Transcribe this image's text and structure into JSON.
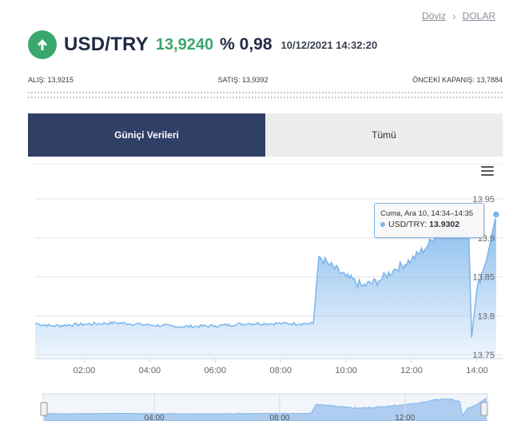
{
  "breadcrumb": {
    "items": [
      "Döviz",
      "DOLAR"
    ]
  },
  "header": {
    "pair": "USD/TRY",
    "price": "13,9240",
    "change": "% 0,98",
    "datetime": "10/12/2021 14:32:20",
    "trend_icon": "arrow-up-icon",
    "up_color": "#3aa76d"
  },
  "info": {
    "buy": "ALIŞ: 13,9215",
    "sell": "SATIŞ: 13,9392",
    "prev_close": "ÖNCEKİ KAPANIŞ: 13,7884"
  },
  "tabs": [
    {
      "label": "Güniçi Verileri",
      "active": true
    },
    {
      "label": "Tümü",
      "active": false
    }
  ],
  "tooltip": {
    "title": "Cuma, Ara 10, 14:34–14:35",
    "series": "USD/TRY: ",
    "value": "13.9302"
  },
  "chart_data": {
    "type": "area",
    "series_name": "USD/TRY",
    "color": "#7cb5ec",
    "x_ticks": [
      "02:00",
      "04:00",
      "06:00",
      "08:00",
      "10:00",
      "12:00",
      "14:00"
    ],
    "y_ticks": [
      "13.75",
      "13.8",
      "13.85",
      "13.9",
      "13.95"
    ],
    "ylim": [
      13.75,
      13.95
    ],
    "x": [
      "00:30",
      "01:00",
      "02:00",
      "03:00",
      "04:00",
      "05:00",
      "06:00",
      "07:00",
      "08:00",
      "08:45",
      "09:00",
      "09:10",
      "09:30",
      "10:00",
      "10:30",
      "11:00",
      "11:30",
      "12:00",
      "12:30",
      "13:00",
      "13:30",
      "13:45",
      "13:50",
      "14:00",
      "14:20",
      "14:35"
    ],
    "values": [
      13.79,
      13.787,
      13.789,
      13.791,
      13.788,
      13.786,
      13.787,
      13.79,
      13.79,
      13.79,
      13.79,
      13.876,
      13.865,
      13.85,
      13.838,
      13.845,
      13.86,
      13.872,
      13.89,
      13.922,
      13.924,
      13.9,
      13.772,
      13.835,
      13.88,
      13.93
    ],
    "navigator_ticks": [
      "04:00",
      "08:00",
      "12:00"
    ]
  }
}
